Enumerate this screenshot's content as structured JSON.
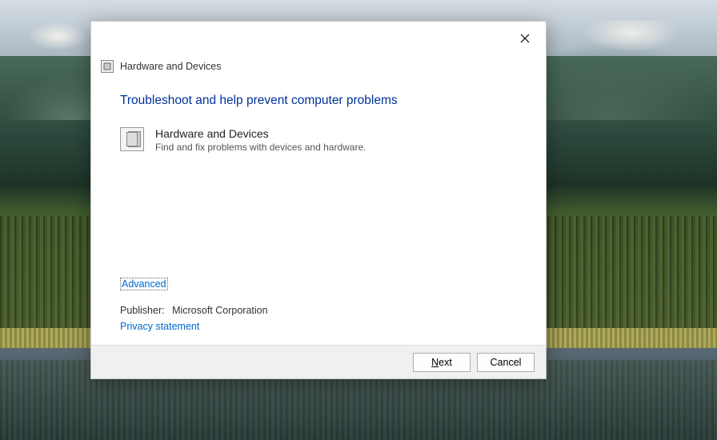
{
  "window": {
    "title": "Hardware and Devices"
  },
  "main": {
    "heading": "Troubleshoot and help prevent computer problems",
    "item": {
      "title": "Hardware and Devices",
      "description": "Find and fix problems with devices and hardware."
    },
    "advanced_link": "Advanced",
    "publisher_label": "Publisher:",
    "publisher_value": "Microsoft Corporation",
    "privacy_link": "Privacy statement"
  },
  "footer": {
    "next_prefix": "N",
    "next_rest": "ext",
    "cancel": "Cancel"
  }
}
